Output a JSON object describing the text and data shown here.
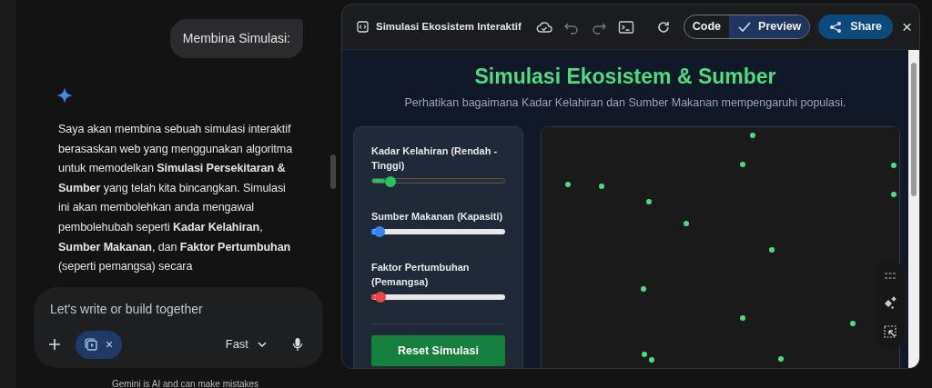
{
  "chat": {
    "user_message": "Membina Simulasi:",
    "reply": "Saya akan membina sebuah simulasi interaktif berasaskan web yang menggunakan algoritma untuk memodelkan **Simulasi Persekitaran & Sumber** yang telah kita bincangkan. Simulasi ini akan membolehkan anda mengawal pembolehubah seperti **Kadar Kelahiran**, **Sumber Makanan**, dan **Faktor Pertumbuhan** (seperti pemangsa) secara",
    "input": {
      "placeholder": "Let's write or build together"
    },
    "chip_close": "×",
    "mode": "Fast",
    "disclaimer": "Gemini is AI and can make mistakes"
  },
  "canvas_panel": {
    "title": "Simulasi Ekosistem Interaktif",
    "view_toggle": [
      {
        "label": "Code",
        "selected": false
      },
      {
        "label": "Preview",
        "selected": true
      }
    ],
    "share": "Share",
    "close": "×"
  },
  "preview": {
    "heading": "Simulasi Ekosistem & Sumber",
    "subtitle": "Perhatikan bagaimana Kadar Kelahiran dan Sumber Makanan mempengaruhi populasi.",
    "sliders": [
      {
        "label": "Kadar Kelahiran (Rendah - Tinggi)",
        "level": 0.14,
        "color": "#22c55e",
        "kind": "dark"
      },
      {
        "label": "Sumber Makanan (Kapasiti)",
        "level": 0.06,
        "color": "#3b82f6",
        "kind": "light"
      },
      {
        "label": "Faktor Pertumbuhan (Pemangsa)",
        "level": 0.07,
        "color": "#ef4444",
        "kind": "light"
      }
    ],
    "reset_button": "Reset Simulasi"
  }
}
